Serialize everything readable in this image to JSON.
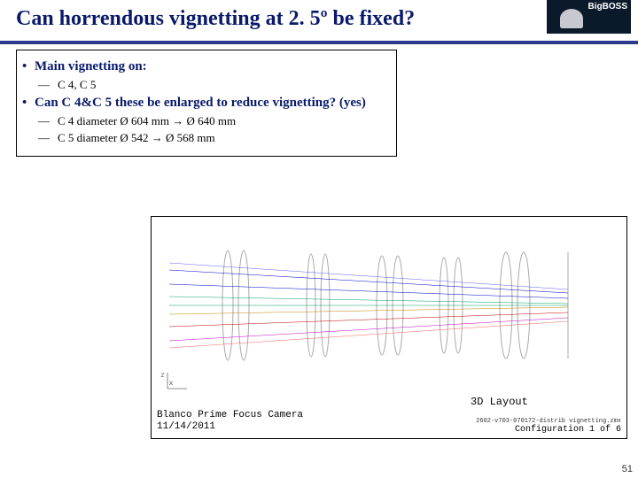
{
  "header": {
    "title": "Can horrendous vignetting at 2. 5º be fixed?",
    "brand": "BigBOSS"
  },
  "bullets": {
    "b1": "Main vignetting on:",
    "b1a": "C 4, C 5",
    "b2": "Can C 4&C 5 these be enlarged to reduce vignetting? (yes)",
    "b2a": "C 4 diameter Ø 604 mm → Ø 640 mm",
    "b2b": "C 5 diameter Ø 542 → Ø 568 mm"
  },
  "figure": {
    "label3d": "3D Layout",
    "footer1": "Blanco Prime Focus Camera",
    "footer2": "11/14/2011",
    "cfgfile": "2602-v703-070172-distrib vignetting.zmx",
    "cfg": "Configuration 1 of 6"
  },
  "page": "51"
}
